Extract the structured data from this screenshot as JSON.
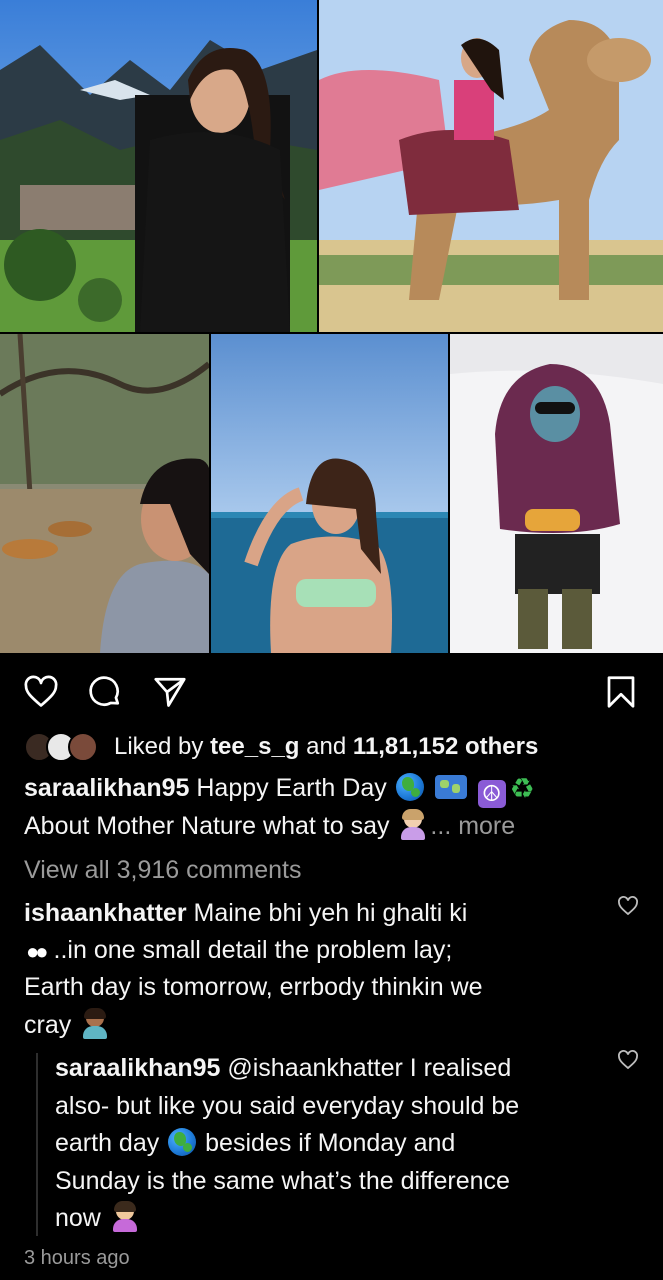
{
  "post": {
    "photos": [
      {
        "name": "photo-mountain-portrait",
        "description": "woman in black sweater, mountains"
      },
      {
        "name": "photo-camel-ride",
        "description": "woman riding camel"
      },
      {
        "name": "photo-tigers-forest",
        "description": "woman watching tigers"
      },
      {
        "name": "photo-beach",
        "description": "woman on beach"
      },
      {
        "name": "photo-snow",
        "description": "person in snow jacket"
      }
    ]
  },
  "actions": {
    "like_icon": "heart-icon",
    "comment_icon": "comment-icon",
    "share_icon": "share-icon",
    "save_icon": "bookmark-icon"
  },
  "likes": {
    "prefix": "Liked by ",
    "user": "tee_s_g",
    "middle": " and ",
    "count": "11,81,152 others"
  },
  "caption": {
    "username": "saraalikhan95",
    "line1": "Happy Earth Day",
    "line2": "About Mother Nature what to say",
    "more": "... more"
  },
  "view_comments": "View all 3,916 comments",
  "comment1": {
    "username": "ishaankhatter",
    "line1": "Maine bhi yeh hi ghalti ki",
    "line2": "..in one small detail the problem lay;",
    "line3": "Earth day is tomorrow, errbody thinkin we",
    "line4": "cray"
  },
  "reply1": {
    "username": "saraalikhan95",
    "mention": "@ishaankhatter",
    "line1_rest": " I realised",
    "line2": "also- but like you said everyday should be",
    "line3a": "earth day",
    "line3b": "besides if Monday and",
    "line4": "Sunday is the same what’s the difference",
    "line5": "now"
  },
  "timestamp": "3 hours ago",
  "colors": {
    "background": "#000000",
    "text": "#f5f5f5",
    "muted": "#9a9a9a"
  }
}
